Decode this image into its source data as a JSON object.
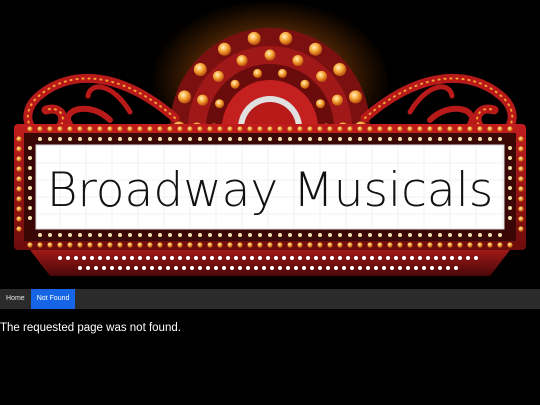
{
  "banner": {
    "title": "Broadway Musicals",
    "colors": {
      "frame": "#a01818",
      "bulb": "#f6a434",
      "sign_bg": "#ffffff",
      "text": "#111111"
    }
  },
  "nav": {
    "items": [
      {
        "label": "Home",
        "active": false
      },
      {
        "label": "Not Found",
        "active": true
      }
    ],
    "colors": {
      "bar": "#2b2b2b",
      "active": "#1565e6"
    }
  },
  "main": {
    "message": "The requested page was not found."
  }
}
